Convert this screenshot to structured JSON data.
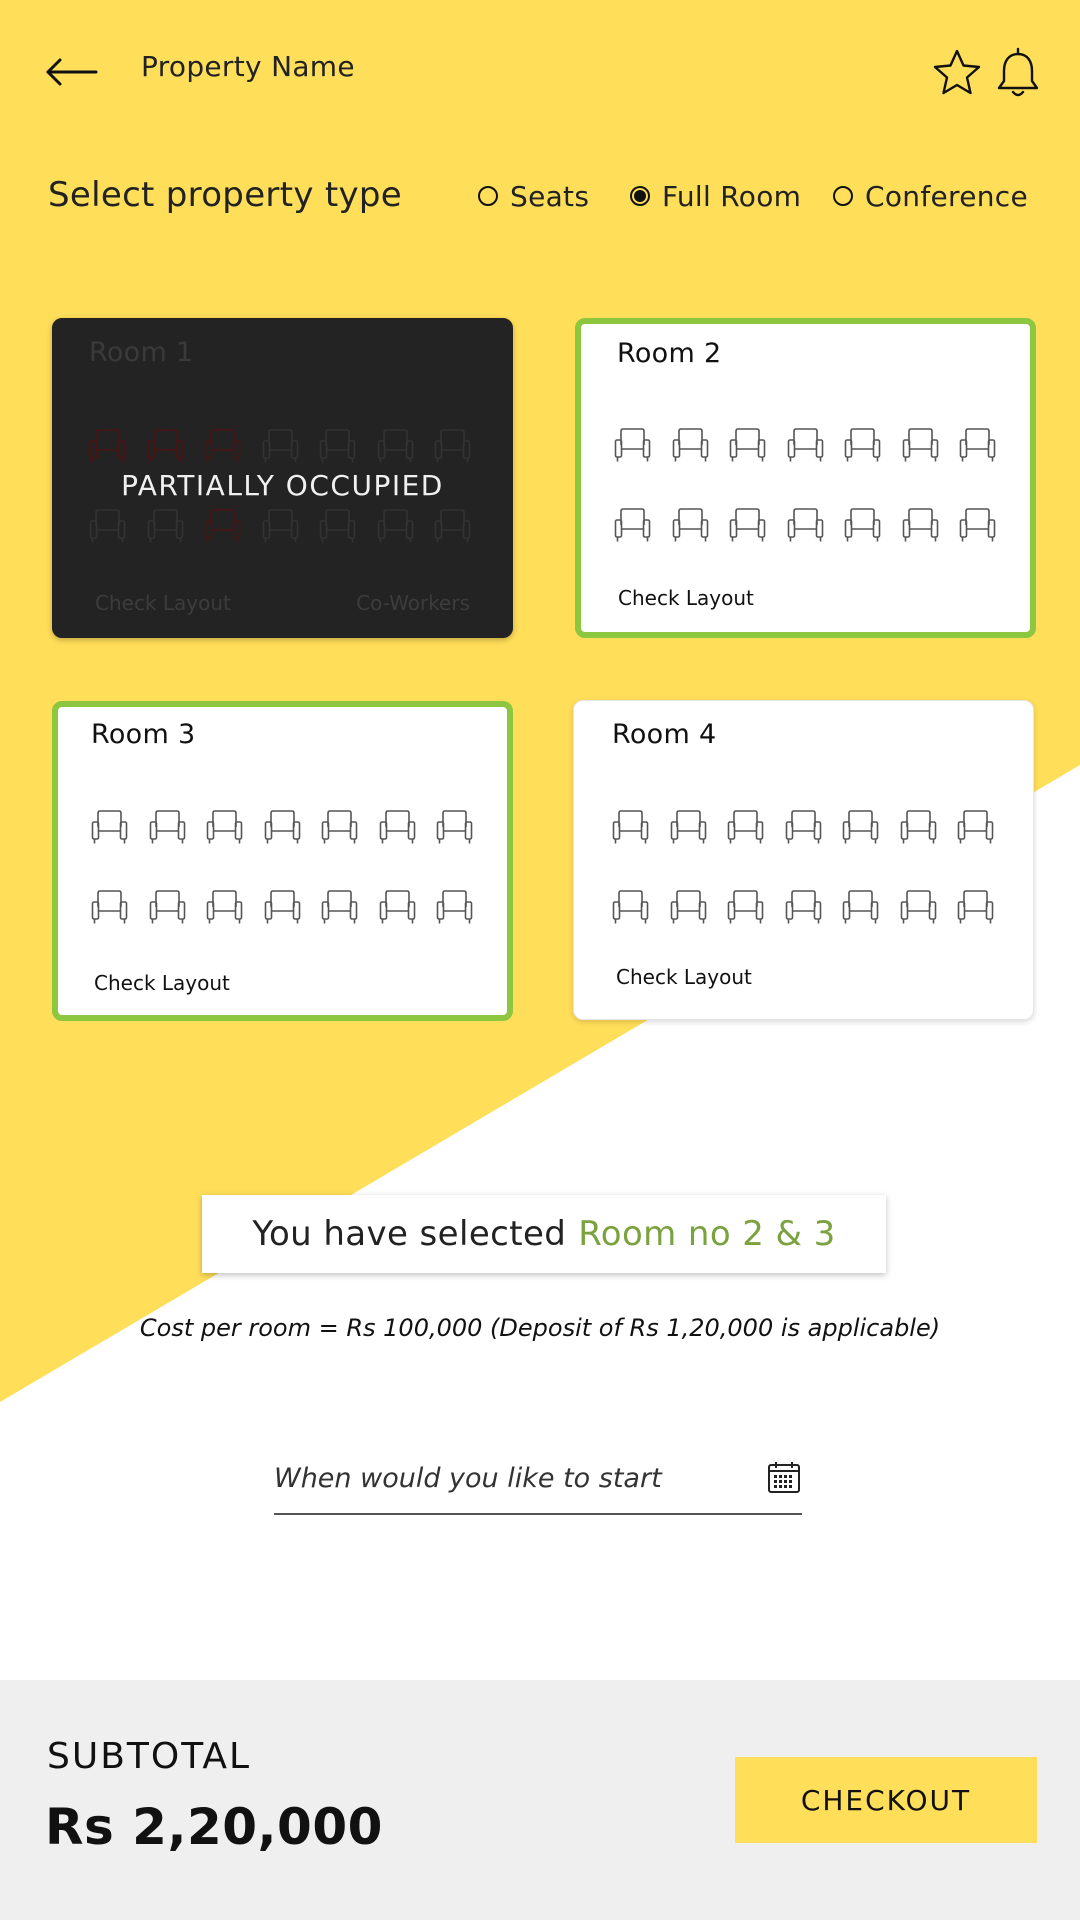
{
  "header": {
    "title": "Property Name",
    "back_icon": "arrow-left-icon",
    "favorite_icon": "star-icon",
    "notification_icon": "bell-icon"
  },
  "property_type": {
    "title": "Select property type",
    "options": [
      {
        "label": "Seats",
        "selected": false
      },
      {
        "label": "Full Room",
        "selected": true
      },
      {
        "label": "Conference",
        "selected": false
      }
    ]
  },
  "rooms": [
    {
      "name": "Room 1",
      "status": "PARTIALLY OCCUPIED",
      "link": "Check Layout",
      "secondary_link": "Co-Workers",
      "seat_rows": [
        [
          "occupied",
          "occupied",
          "occupied",
          "free",
          "free",
          "free",
          "free"
        ],
        [
          "free",
          "free",
          "occupied",
          "free",
          "free",
          "free",
          "free"
        ]
      ]
    },
    {
      "name": "Room 2",
      "selected": true,
      "link": "Check Layout",
      "seat_rows": [
        [
          "free",
          "free",
          "free",
          "free",
          "free",
          "free",
          "free"
        ],
        [
          "free",
          "free",
          "free",
          "free",
          "free",
          "free",
          "free"
        ]
      ]
    },
    {
      "name": "Room 3",
      "selected": true,
      "link": "Check Layout",
      "seat_rows": [
        [
          "free",
          "free",
          "free",
          "free",
          "free",
          "free",
          "free"
        ],
        [
          "free",
          "free",
          "free",
          "free",
          "free",
          "free",
          "free"
        ]
      ]
    },
    {
      "name": "Room 4",
      "selected": false,
      "link": "Check Layout",
      "seat_rows": [
        [
          "free",
          "free",
          "free",
          "free",
          "free",
          "free",
          "free"
        ],
        [
          "free",
          "free",
          "free",
          "free",
          "free",
          "free",
          "free"
        ]
      ]
    }
  ],
  "selection": {
    "prefix": "You have selected",
    "rooms": "Room no 2 & 3",
    "cost_note": "Cost per room = Rs 100,000 (Deposit of Rs 1,20,000 is applicable)"
  },
  "start_date": {
    "placeholder": "When would you like to start",
    "icon": "calendar-icon"
  },
  "footer": {
    "subtotal_label": "SUBTOTAL",
    "subtotal_amount": "Rs 2,20,000",
    "checkout_label": "CHECKOUT"
  },
  "colors": {
    "yellow": "#ffde59",
    "selected_border": "#8dc63f",
    "selected_text": "#7ba23f",
    "occupied_card": "#232323",
    "occupied_seat": "#4a1414",
    "footer_bg": "#efefef"
  }
}
